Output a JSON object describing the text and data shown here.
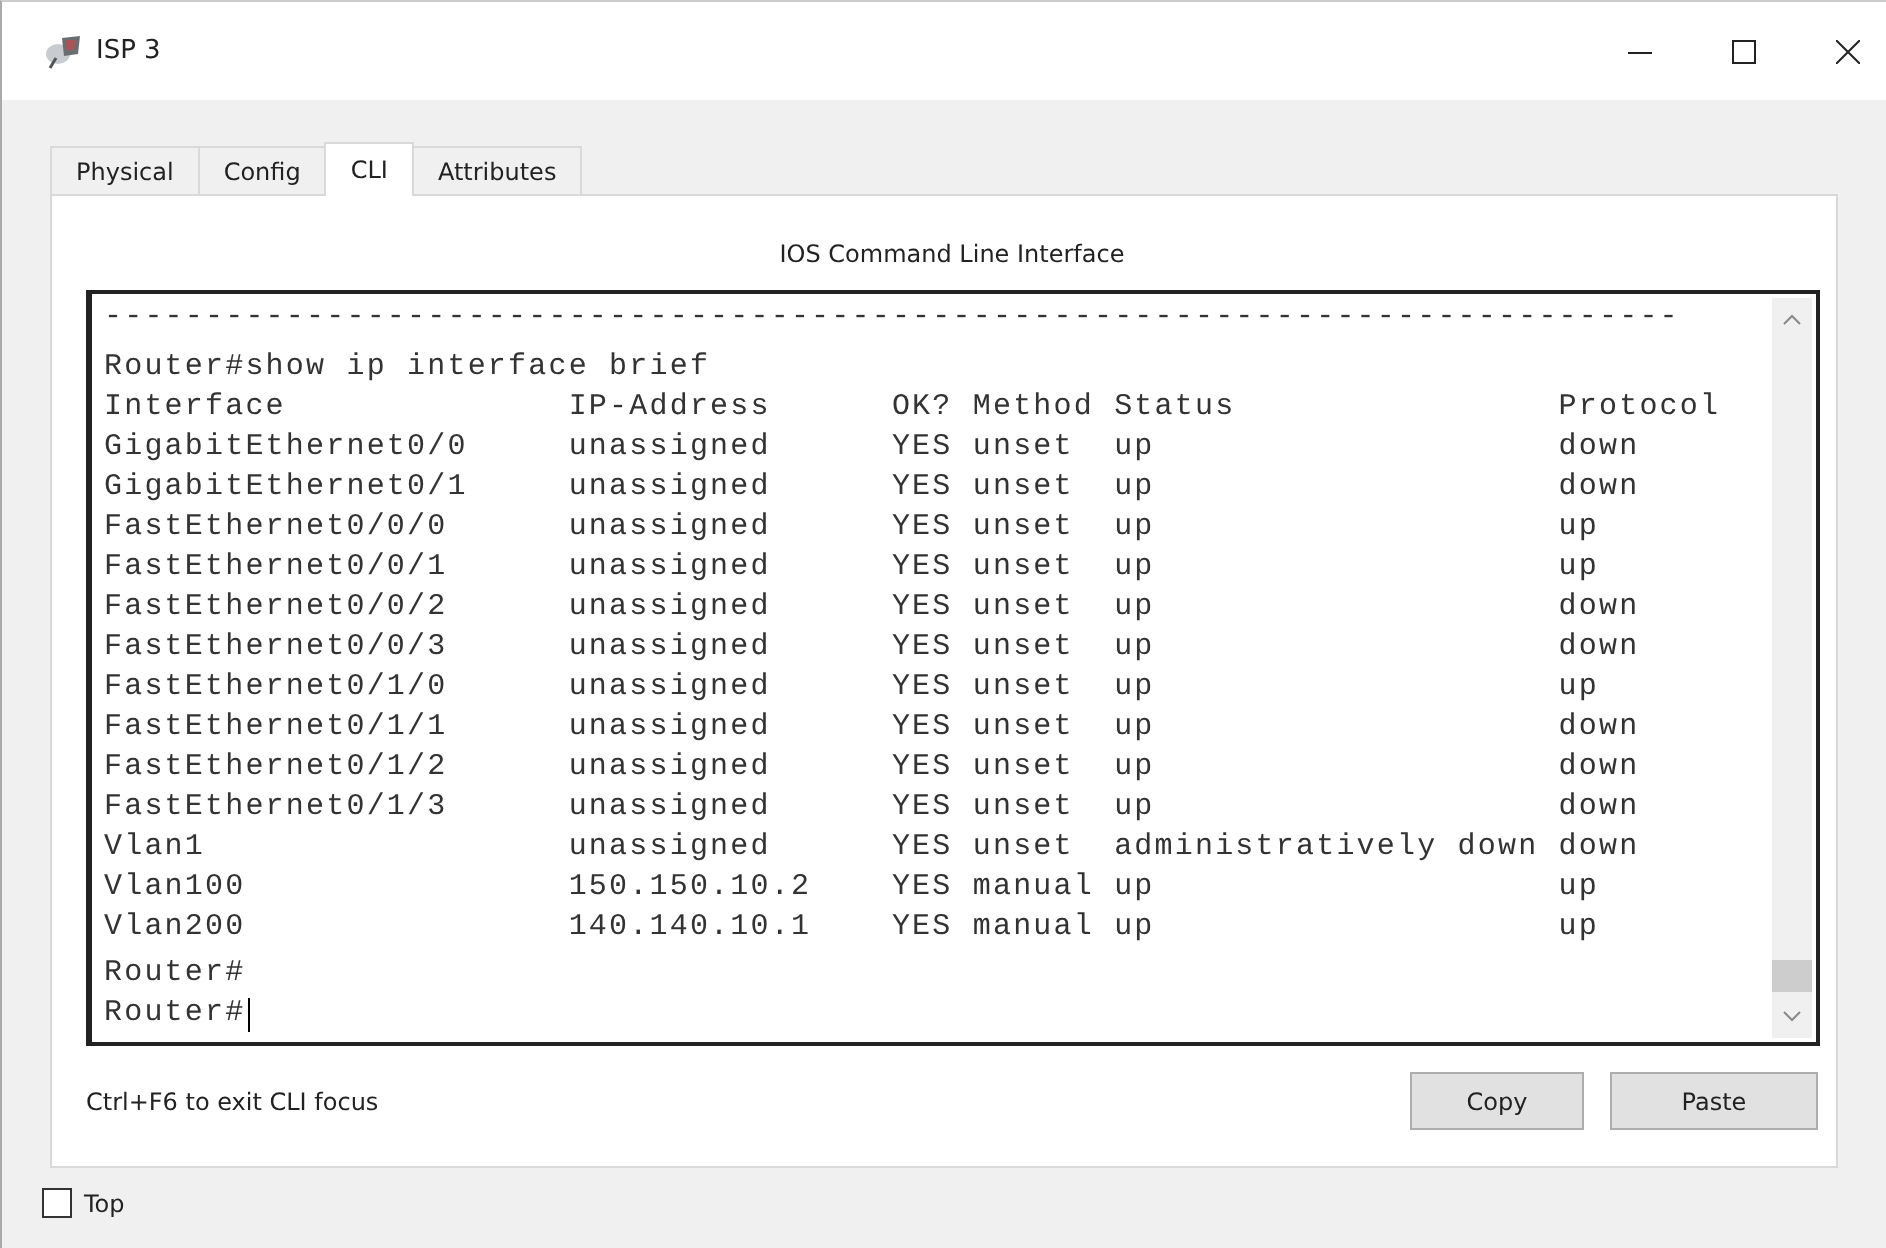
{
  "window": {
    "title": "ISP 3"
  },
  "tabs": [
    {
      "label": "Physical",
      "selected": false
    },
    {
      "label": "Config",
      "selected": false
    },
    {
      "label": "CLI",
      "selected": true
    },
    {
      "label": "Attributes",
      "selected": false
    }
  ],
  "cli": {
    "heading": "IOS Command Line Interface",
    "lines": [
      {
        "kind": "separator",
        "text": "------------------------------------------------------------------------------",
        "cursor": false
      },
      {
        "kind": "command",
        "text": "Router#show ip interface brief",
        "cursor": false
      },
      {
        "kind": "output",
        "text": "Interface              IP-Address      OK? Method Status                Protocol",
        "cursor": false
      },
      {
        "kind": "output",
        "text": "GigabitEthernet0/0     unassigned      YES unset  up                    down",
        "cursor": false
      },
      {
        "kind": "output",
        "text": "GigabitEthernet0/1     unassigned      YES unset  up                    down",
        "cursor": false
      },
      {
        "kind": "output",
        "text": "FastEthernet0/0/0      unassigned      YES unset  up                    up",
        "cursor": false
      },
      {
        "kind": "output",
        "text": "FastEthernet0/0/1      unassigned      YES unset  up                    up",
        "cursor": false
      },
      {
        "kind": "output",
        "text": "FastEthernet0/0/2      unassigned      YES unset  up                    down",
        "cursor": false
      },
      {
        "kind": "output",
        "text": "FastEthernet0/0/3      unassigned      YES unset  up                    down",
        "cursor": false
      },
      {
        "kind": "output",
        "text": "FastEthernet0/1/0      unassigned      YES unset  up                    up",
        "cursor": false
      },
      {
        "kind": "output",
        "text": "FastEthernet0/1/1      unassigned      YES unset  up                    down",
        "cursor": false
      },
      {
        "kind": "output",
        "text": "FastEthernet0/1/2      unassigned      YES unset  up                    down",
        "cursor": false
      },
      {
        "kind": "output",
        "text": "FastEthernet0/1/3      unassigned      YES unset  up                    down",
        "cursor": false
      },
      {
        "kind": "output",
        "text": "Vlan1                  unassigned      YES unset  administratively down down",
        "cursor": false
      },
      {
        "kind": "output",
        "text": "Vlan100                150.150.10.2    YES manual up                    up",
        "cursor": false
      },
      {
        "kind": "output",
        "text": "Vlan200                140.140.10.1    YES manual up                    up",
        "cursor": false
      },
      {
        "kind": "prompt",
        "text": "Router#",
        "cursor": false
      },
      {
        "kind": "prompt",
        "text": "Router#",
        "cursor": true
      }
    ],
    "hint": "Ctrl+F6 to exit CLI focus",
    "buttons": [
      "Copy",
      "Paste"
    ]
  },
  "top_checkbox": {
    "label": "Top",
    "checked": false
  }
}
